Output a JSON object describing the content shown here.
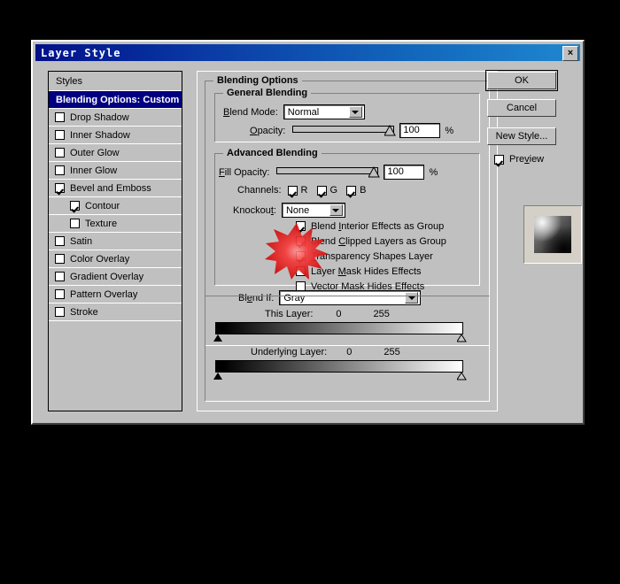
{
  "dialog": {
    "title": "Layer Style",
    "close_label": "×"
  },
  "styles_panel": {
    "header": "Styles",
    "items": [
      {
        "label": "Blending Options: Custom",
        "checked": null,
        "selected": true,
        "indent": false
      },
      {
        "label": "Drop Shadow",
        "checked": false,
        "selected": false,
        "indent": false
      },
      {
        "label": "Inner Shadow",
        "checked": false,
        "selected": false,
        "indent": false
      },
      {
        "label": "Outer Glow",
        "checked": false,
        "selected": false,
        "indent": false
      },
      {
        "label": "Inner Glow",
        "checked": false,
        "selected": false,
        "indent": false
      },
      {
        "label": "Bevel and Emboss",
        "checked": true,
        "selected": false,
        "indent": false
      },
      {
        "label": "Contour",
        "checked": true,
        "selected": false,
        "indent": true
      },
      {
        "label": "Texture",
        "checked": false,
        "selected": false,
        "indent": true
      },
      {
        "label": "Satin",
        "checked": false,
        "selected": false,
        "indent": false
      },
      {
        "label": "Color Overlay",
        "checked": false,
        "selected": false,
        "indent": false
      },
      {
        "label": "Gradient Overlay",
        "checked": false,
        "selected": false,
        "indent": false
      },
      {
        "label": "Pattern Overlay",
        "checked": false,
        "selected": false,
        "indent": false
      },
      {
        "label": "Stroke",
        "checked": false,
        "selected": false,
        "indent": false
      }
    ]
  },
  "blending_options": {
    "legend": "Blending Options",
    "general": {
      "legend": "General Blending",
      "blend_mode_label": "Blend Mode:",
      "blend_mode_value": "Normal",
      "opacity_label": "Opacity:",
      "opacity_value": "100",
      "opacity_unit": "%",
      "opacity_percent": 100
    },
    "advanced": {
      "legend": "Advanced Blending",
      "fill_opacity_label": "Fill Opacity:",
      "fill_opacity_value": "100",
      "fill_opacity_unit": "%",
      "fill_opacity_percent": 100,
      "channels_label": "Channels:",
      "channels": [
        {
          "label": "R",
          "checked": true
        },
        {
          "label": "G",
          "checked": true
        },
        {
          "label": "B",
          "checked": true
        }
      ],
      "knockout_label": "Knockout:",
      "knockout_value": "None",
      "checkboxes": [
        {
          "label": "Blend Interior Effects as Group",
          "checked": true
        },
        {
          "label": "Blend Clipped Layers as Group",
          "checked": true
        },
        {
          "label": "Transparency Shapes Layer",
          "checked": true
        },
        {
          "label": "Layer Mask Hides Effects",
          "checked": false
        },
        {
          "label": "Vector Mask Hides Effects",
          "checked": false
        }
      ]
    },
    "blend_if": {
      "label": "Blend If:",
      "value": "Gray",
      "this_layer": {
        "label": "This Layer:",
        "min": "0",
        "max": "255"
      },
      "underlying_layer": {
        "label": "Underlying Layer:",
        "min": "0",
        "max": "255"
      }
    }
  },
  "buttons": {
    "ok": "OK",
    "cancel": "Cancel",
    "new_style": "New Style...",
    "preview_label": "Preview",
    "preview_checked": true
  },
  "annotation": {
    "type": "starburst-highlight",
    "color": "#ee2222"
  }
}
